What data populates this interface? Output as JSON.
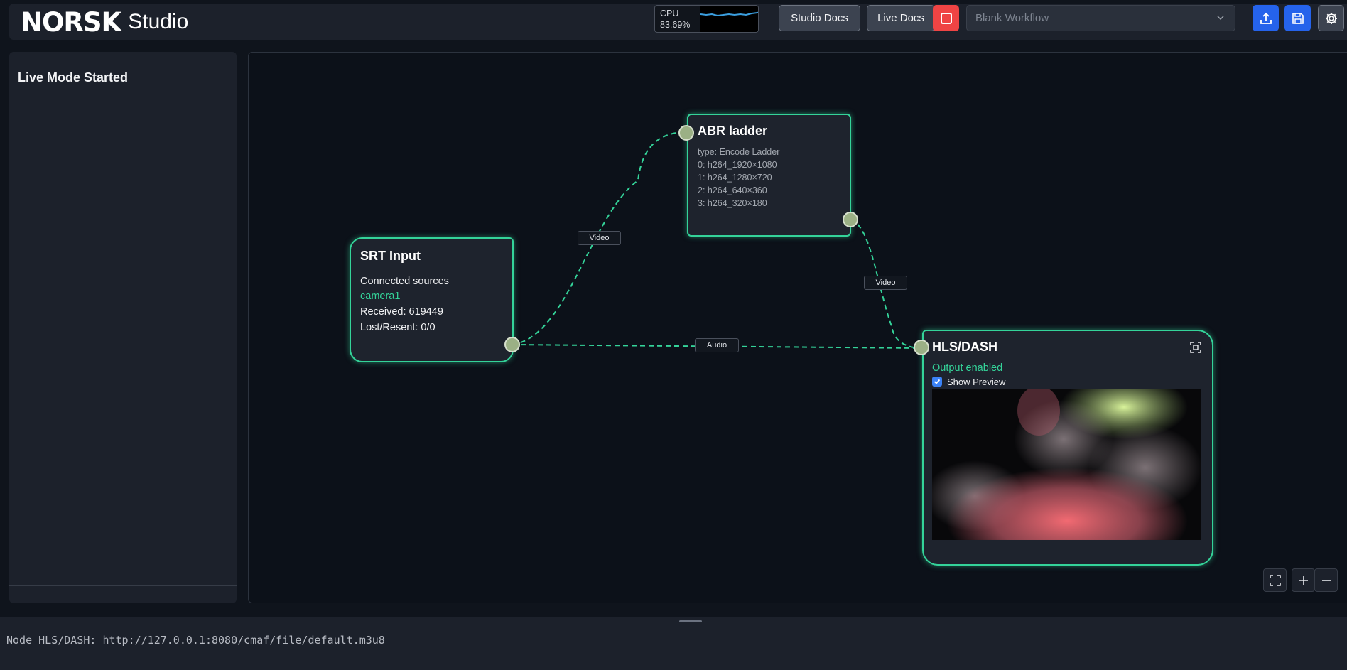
{
  "header": {
    "brand": "NORSK",
    "product": "Studio",
    "cpu_label": "CPU",
    "cpu_value": "83.69%",
    "studio_docs_label": "Studio Docs",
    "live_docs_label": "Live Docs",
    "workflow_placeholder": "Blank Workflow"
  },
  "sidebar": {
    "title": "Live Mode Started"
  },
  "nodes": {
    "srt": {
      "title": "SRT Input",
      "sources_label": "Connected sources",
      "source_name": "camera1",
      "received": "Received: 619449",
      "lost": "Lost/Resent: 0/0"
    },
    "abr": {
      "title": "ABR ladder",
      "type_line": "type: Encode Ladder",
      "rungs": [
        "0: h264_1920×1080",
        "1: h264_1280×720",
        "2: h264_640×360",
        "3: h264_320×180"
      ]
    },
    "hls": {
      "title": "HLS/DASH",
      "status": "Output enabled",
      "preview_label": "Show Preview",
      "preview_checked": true
    }
  },
  "edges": {
    "srt_to_abr": "Video",
    "abr_to_hls": "Video",
    "srt_to_hls": "Audio"
  },
  "log": {
    "line": "Node HLS/DASH: http://127.0.0.1:8080/cmaf/file/default.m3u8"
  },
  "colors": {
    "accent_green": "#34d399",
    "stop_red": "#ef4444",
    "action_blue": "#2563eb",
    "cpu_line": "#3b9fe0"
  }
}
